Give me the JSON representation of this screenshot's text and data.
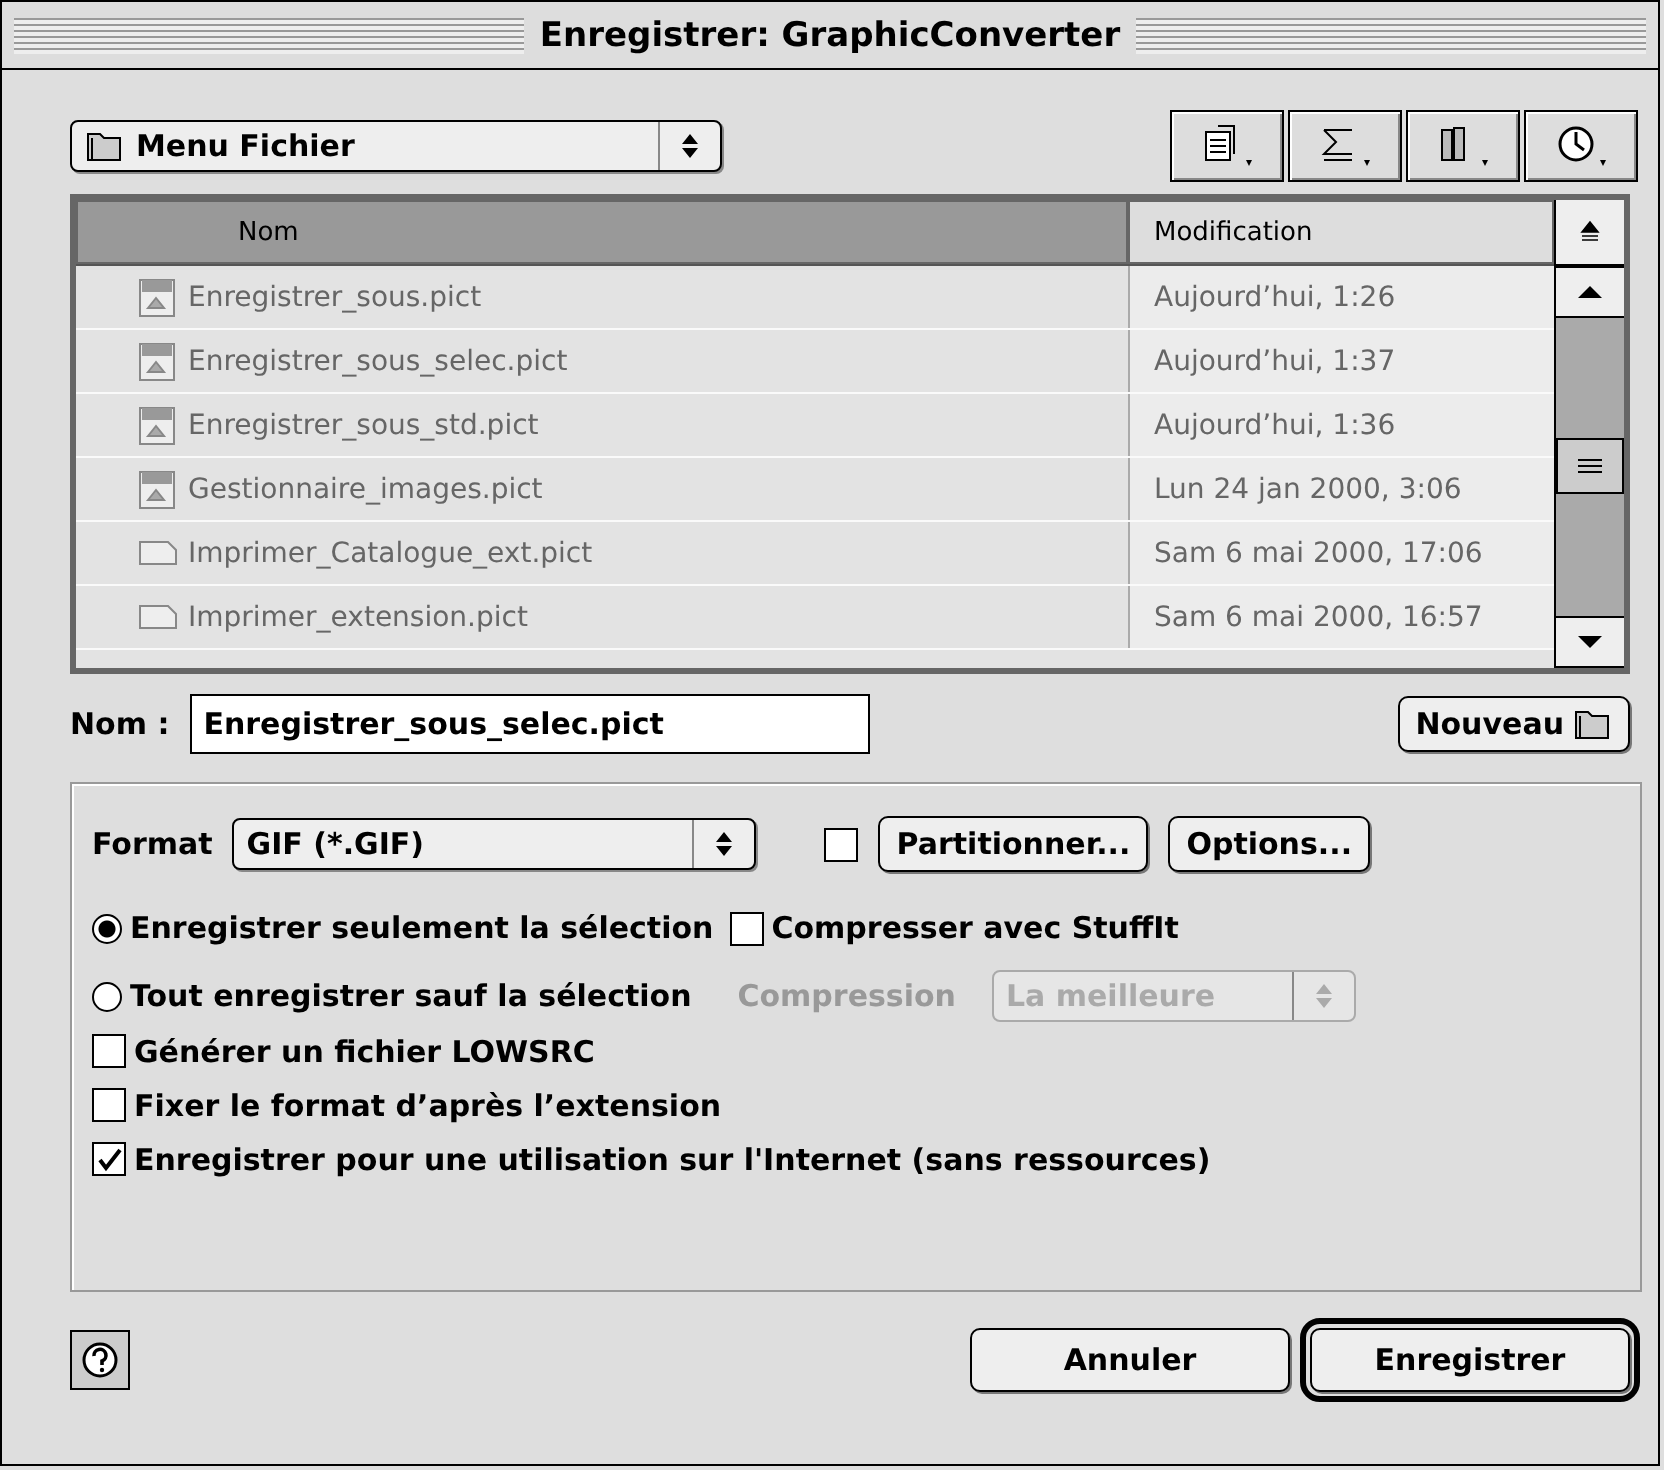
{
  "window": {
    "title": "Enregistrer: GraphicConverter"
  },
  "location_menu": {
    "value": "Menu Fichier"
  },
  "file_list": {
    "columns": [
      {
        "label": "Nom",
        "selected": true
      },
      {
        "label": "Modification",
        "selected": false
      }
    ],
    "rows": [
      {
        "name": "Enregistrer_sous.pict",
        "modified": "Aujourd’hui, 1:26",
        "kind": "gif"
      },
      {
        "name": "Enregistrer_sous_selec.pict",
        "modified": "Aujourd’hui, 1:37",
        "kind": "gif"
      },
      {
        "name": "Enregistrer_sous_std.pict",
        "modified": "Aujourd’hui, 1:36",
        "kind": "gif"
      },
      {
        "name": "Gestionnaire_images.pict",
        "modified": "Lun 24 jan 2000, 3:06",
        "kind": "pict"
      },
      {
        "name": "Imprimer_Catalogue_ext.pict",
        "modified": "Sam 6 mai 2000, 17:06",
        "kind": "doc"
      },
      {
        "name": "Imprimer_extension.pict",
        "modified": "Sam 6 mai 2000, 16:57",
        "kind": "doc"
      }
    ]
  },
  "name_field": {
    "label": "Nom :",
    "value": "Enregistrer_sous_selec.pict"
  },
  "new_button": {
    "label": "Nouveau"
  },
  "format": {
    "label": "Format",
    "value": "GIF (*.GIF)"
  },
  "partition": {
    "checked": false,
    "button": "Partitionner..."
  },
  "options_button": {
    "label": "Options..."
  },
  "save_scope": [
    {
      "label": "Enregistrer seulement la sélection",
      "selected": true
    },
    {
      "label": "Tout enregistrer sauf la sélection",
      "selected": false
    }
  ],
  "compress": {
    "label": "Compresser avec StuffIt",
    "checked": false
  },
  "compression": {
    "label": "Compression",
    "value": "La meilleure",
    "disabled": true
  },
  "options": [
    {
      "label": "Générer un fichier LOWSRC",
      "checked": false
    },
    {
      "label": "Fixer le format d’après l’extension",
      "checked": false
    },
    {
      "label": "Enregistrer pour une utilisation sur l'Internet (sans ressources)",
      "checked": true
    }
  ],
  "buttons": [
    {
      "label": "Annuler",
      "default": false
    },
    {
      "label": "Enregistrer",
      "default": true
    }
  ]
}
